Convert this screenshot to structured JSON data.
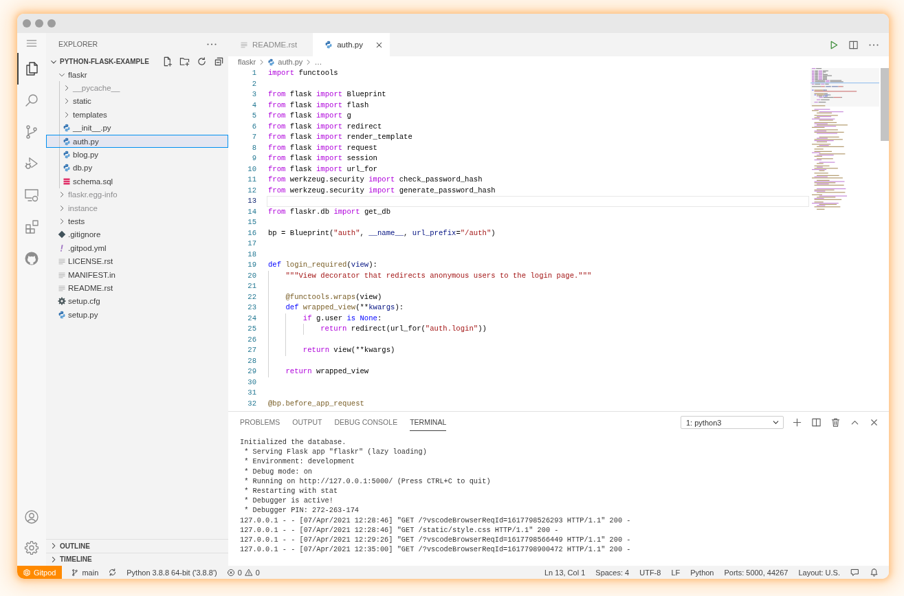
{
  "activity_bar": {
    "items": [
      {
        "kind": "files",
        "selected": true
      },
      {
        "kind": "search",
        "selected": false
      },
      {
        "kind": "source_control",
        "selected": false
      },
      {
        "kind": "run_debug",
        "selected": false
      },
      {
        "kind": "remote",
        "selected": false
      },
      {
        "kind": "extensions",
        "selected": false
      },
      {
        "kind": "github",
        "selected": false
      }
    ],
    "bottom": [
      {
        "kind": "account"
      },
      {
        "kind": "settings"
      }
    ]
  },
  "sidebar": {
    "title": "EXPLORER",
    "folder": {
      "name": "PYTHON-FLASK-EXAMPLE",
      "expanded": true,
      "children": [
        {
          "name": "flaskr",
          "kind": "folder",
          "expanded": true,
          "selected": false,
          "ignored": false,
          "children": [
            {
              "name": "__pycache__",
              "kind": "folder",
              "expanded": false,
              "selected": false,
              "ignored": true
            },
            {
              "name": "static",
              "kind": "folder",
              "expanded": false,
              "selected": false,
              "ignored": false
            },
            {
              "name": "templates",
              "kind": "folder",
              "expanded": false,
              "selected": false,
              "ignored": false
            },
            {
              "name": "__init__.py",
              "kind": "python",
              "selected": false,
              "ignored": false
            },
            {
              "name": "auth.py",
              "kind": "python",
              "selected": true,
              "ignored": false
            },
            {
              "name": "blog.py",
              "kind": "python",
              "selected": false,
              "ignored": false
            },
            {
              "name": "db.py",
              "kind": "python",
              "selected": false,
              "ignored": false
            },
            {
              "name": "schema.sql",
              "kind": "database",
              "selected": false,
              "ignored": false
            }
          ]
        },
        {
          "name": "flaskr.egg-info",
          "kind": "folder",
          "expanded": false,
          "selected": false,
          "ignored": true
        },
        {
          "name": "instance",
          "kind": "folder",
          "expanded": false,
          "selected": false,
          "ignored": true
        },
        {
          "name": "tests",
          "kind": "folder",
          "expanded": false,
          "selected": false,
          "ignored": false
        },
        {
          "name": ".gitignore",
          "kind": "git",
          "selected": false,
          "ignored": false
        },
        {
          "name": ".gitpod.yml",
          "kind": "yaml",
          "selected": false,
          "ignored": false
        },
        {
          "name": "LICENSE.rst",
          "kind": "text",
          "selected": false,
          "ignored": false
        },
        {
          "name": "MANIFEST.in",
          "kind": "text",
          "selected": false,
          "ignored": false
        },
        {
          "name": "README.rst",
          "kind": "text",
          "selected": false,
          "ignored": false
        },
        {
          "name": "setup.cfg",
          "kind": "gear",
          "selected": false,
          "ignored": false
        },
        {
          "name": "setup.py",
          "kind": "python",
          "selected": false,
          "ignored": false
        }
      ]
    },
    "sections": [
      {
        "title": "OUTLINE",
        "expanded": false
      },
      {
        "title": "TIMELINE",
        "expanded": false
      }
    ]
  },
  "editor": {
    "tabs": [
      {
        "label": "README.rst",
        "kind": "text",
        "selected": false
      },
      {
        "label": "auth.py",
        "kind": "python",
        "selected": true
      }
    ],
    "breadcrumb": [
      {
        "label": "flaskr",
        "kind": "folder"
      },
      {
        "label": "auth.py",
        "kind": "python"
      },
      {
        "label": "…",
        "kind": "symbol"
      }
    ],
    "lines": [
      {
        "number": "1",
        "current": false,
        "tokens": [
          {
            "text": "import",
            "kind": "keyword"
          },
          {
            "text": " functools",
            "kind": "plain"
          }
        ]
      },
      {
        "number": "2",
        "current": false
      },
      {
        "number": "3",
        "current": false,
        "tokens": [
          {
            "text": "from",
            "kind": "keyword"
          },
          {
            "text": " flask ",
            "kind": "plain"
          },
          {
            "text": "import",
            "kind": "keyword"
          },
          {
            "text": " Blueprint",
            "kind": "plain"
          }
        ]
      },
      {
        "number": "4",
        "current": false,
        "tokens": [
          {
            "text": "from",
            "kind": "keyword"
          },
          {
            "text": " flask ",
            "kind": "plain"
          },
          {
            "text": "import",
            "kind": "keyword"
          },
          {
            "text": " flash",
            "kind": "plain"
          }
        ]
      },
      {
        "number": "5",
        "current": false,
        "tokens": [
          {
            "text": "from",
            "kind": "keyword"
          },
          {
            "text": " flask ",
            "kind": "plain"
          },
          {
            "text": "import",
            "kind": "keyword"
          },
          {
            "text": " g",
            "kind": "plain"
          }
        ]
      },
      {
        "number": "6",
        "current": false,
        "tokens": [
          {
            "text": "from",
            "kind": "keyword"
          },
          {
            "text": " flask ",
            "kind": "plain"
          },
          {
            "text": "import",
            "kind": "keyword"
          },
          {
            "text": " redirect",
            "kind": "plain"
          }
        ]
      },
      {
        "number": "7",
        "current": false,
        "tokens": [
          {
            "text": "from",
            "kind": "keyword"
          },
          {
            "text": " flask ",
            "kind": "plain"
          },
          {
            "text": "import",
            "kind": "keyword"
          },
          {
            "text": " render_template",
            "kind": "plain"
          }
        ]
      },
      {
        "number": "8",
        "current": false,
        "tokens": [
          {
            "text": "from",
            "kind": "keyword"
          },
          {
            "text": " flask ",
            "kind": "plain"
          },
          {
            "text": "import",
            "kind": "keyword"
          },
          {
            "text": " request",
            "kind": "plain"
          }
        ]
      },
      {
        "number": "9",
        "current": false,
        "tokens": [
          {
            "text": "from",
            "kind": "keyword"
          },
          {
            "text": " flask ",
            "kind": "plain"
          },
          {
            "text": "import",
            "kind": "keyword"
          },
          {
            "text": " session",
            "kind": "plain"
          }
        ]
      },
      {
        "number": "10",
        "current": false,
        "tokens": [
          {
            "text": "from",
            "kind": "keyword"
          },
          {
            "text": " flask ",
            "kind": "plain"
          },
          {
            "text": "import",
            "kind": "keyword"
          },
          {
            "text": " url_for",
            "kind": "plain"
          }
        ]
      },
      {
        "number": "11",
        "current": false,
        "tokens": [
          {
            "text": "from",
            "kind": "keyword"
          },
          {
            "text": " werkzeug.security ",
            "kind": "plain"
          },
          {
            "text": "import",
            "kind": "keyword"
          },
          {
            "text": " check_password_hash",
            "kind": "plain"
          }
        ]
      },
      {
        "number": "12",
        "current": false,
        "tokens": [
          {
            "text": "from",
            "kind": "keyword"
          },
          {
            "text": " werkzeug.security ",
            "kind": "plain"
          },
          {
            "text": "import",
            "kind": "keyword"
          },
          {
            "text": " generate_password_hash",
            "kind": "plain"
          }
        ]
      },
      {
        "number": "13",
        "current": true
      },
      {
        "number": "14",
        "current": false,
        "tokens": [
          {
            "text": "from",
            "kind": "keyword"
          },
          {
            "text": " flaskr.db ",
            "kind": "plain"
          },
          {
            "text": "import",
            "kind": "keyword"
          },
          {
            "text": " get_db",
            "kind": "plain"
          }
        ]
      },
      {
        "number": "15",
        "current": false
      },
      {
        "number": "16",
        "current": false,
        "tokens": [
          {
            "text": "bp = Blueprint(",
            "kind": "plain"
          },
          {
            "text": "\"auth\"",
            "kind": "string"
          },
          {
            "text": ", ",
            "kind": "plain"
          },
          {
            "text": "__name__",
            "kind": "variable"
          },
          {
            "text": ", ",
            "kind": "plain"
          },
          {
            "text": "url_prefix",
            "kind": "variable"
          },
          {
            "text": "=",
            "kind": "plain"
          },
          {
            "text": "\"/auth\"",
            "kind": "string"
          },
          {
            "text": ")",
            "kind": "plain"
          }
        ]
      },
      {
        "number": "17",
        "current": false
      },
      {
        "number": "18",
        "current": false
      },
      {
        "number": "19",
        "current": false,
        "tokens": [
          {
            "text": "def",
            "kind": "storage"
          },
          {
            "text": " login_required",
            "kind": "function"
          },
          {
            "text": "(",
            "kind": "plain"
          },
          {
            "text": "view",
            "kind": "variable"
          },
          {
            "text": "):",
            "kind": "plain"
          }
        ]
      },
      {
        "number": "20",
        "current": false,
        "tokens": [
          {
            "text": "    \"\"\"View decorator that redirects anonymous users to the login page.\"\"\"",
            "kind": "string"
          }
        ]
      },
      {
        "number": "21",
        "current": false
      },
      {
        "number": "22",
        "current": false,
        "tokens": [
          {
            "text": "    @functools.wraps",
            "kind": "function"
          },
          {
            "text": "(view)",
            "kind": "plain"
          }
        ]
      },
      {
        "number": "23",
        "current": false,
        "tokens": [
          {
            "text": "    def",
            "kind": "storage"
          },
          {
            "text": " wrapped_view",
            "kind": "function"
          },
          {
            "text": "(**",
            "kind": "plain"
          },
          {
            "text": "kwargs",
            "kind": "variable"
          },
          {
            "text": "):",
            "kind": "plain"
          }
        ]
      },
      {
        "number": "24",
        "current": false,
        "tokens": [
          {
            "text": "        if",
            "kind": "keyword"
          },
          {
            "text": " g.user ",
            "kind": "plain"
          },
          {
            "text": "is",
            "kind": "storage"
          },
          {
            "text": " None",
            "kind": "storage"
          },
          {
            "text": ":",
            "kind": "plain"
          }
        ]
      },
      {
        "number": "25",
        "current": false,
        "tokens": [
          {
            "text": "            return",
            "kind": "keyword"
          },
          {
            "text": " redirect(url_for(",
            "kind": "plain"
          },
          {
            "text": "\"auth.login\"",
            "kind": "string"
          },
          {
            "text": "))",
            "kind": "plain"
          }
        ]
      },
      {
        "number": "26",
        "current": false
      },
      {
        "number": "27",
        "current": false,
        "tokens": [
          {
            "text": "        return",
            "kind": "keyword"
          },
          {
            "text": " view(**kwargs)",
            "kind": "plain"
          }
        ]
      },
      {
        "number": "28",
        "current": false
      },
      {
        "number": "29",
        "current": false,
        "tokens": [
          {
            "text": "    return",
            "kind": "keyword"
          },
          {
            "text": " wrapped_view",
            "kind": "plain"
          }
        ]
      },
      {
        "number": "30",
        "current": false
      },
      {
        "number": "31",
        "current": false
      },
      {
        "number": "32",
        "current": false,
        "tokens": [
          {
            "text": "@bp.before_app_request",
            "kind": "function"
          }
        ]
      }
    ]
  },
  "panel": {
    "tabs": [
      {
        "label": "PROBLEMS",
        "selected": false
      },
      {
        "label": "OUTPUT",
        "selected": false
      },
      {
        "label": "DEBUG CONSOLE",
        "selected": false
      },
      {
        "label": "TERMINAL",
        "selected": true
      }
    ],
    "terminal_select": "1: python3",
    "terminal_lines": [
      "Initialized the database.",
      " * Serving Flask app \"flaskr\" (lazy loading)",
      " * Environment: development",
      " * Debug mode: on",
      " * Running on http://127.0.0.1:5000/ (Press CTRL+C to quit)",
      " * Restarting with stat",
      " * Debugger is active!",
      " * Debugger PIN: 272-263-174",
      "127.0.0.1 - - [07/Apr/2021 12:28:46] \"GET /?vscodeBrowserReqId=1617798526293 HTTP/1.1\" 200 -",
      "127.0.0.1 - - [07/Apr/2021 12:28:46] \"GET /static/style.css HTTP/1.1\" 200 -",
      "127.0.0.1 - - [07/Apr/2021 12:29:26] \"GET /?vscodeBrowserReqId=1617798566449 HTTP/1.1\" 200 -",
      "127.0.0.1 - - [07/Apr/2021 12:35:00] \"GET /?vscodeBrowserReqId=1617798900472 HTTP/1.1\" 200 -"
    ]
  },
  "status_bar": {
    "left": [
      {
        "kind": "remote",
        "label": "Gitpod"
      },
      {
        "kind": "branch",
        "label": "main"
      },
      {
        "kind": "sync"
      },
      {
        "kind": "text",
        "label": "Python 3.8.8 64-bit ('3.8.8')"
      },
      {
        "kind": "problems",
        "errors": "0",
        "warnings": "0"
      }
    ],
    "right": [
      {
        "kind": "text",
        "label": "Ln 13, Col 1"
      },
      {
        "kind": "text",
        "label": "Spaces: 4"
      },
      {
        "kind": "text",
        "label": "UTF-8"
      },
      {
        "kind": "text",
        "label": "LF"
      },
      {
        "kind": "text",
        "label": "Python"
      },
      {
        "kind": "text",
        "label": "Ports: 5000, 44267"
      },
      {
        "kind": "text",
        "label": "Layout: U.S."
      },
      {
        "kind": "feedback"
      },
      {
        "kind": "bell"
      }
    ]
  }
}
